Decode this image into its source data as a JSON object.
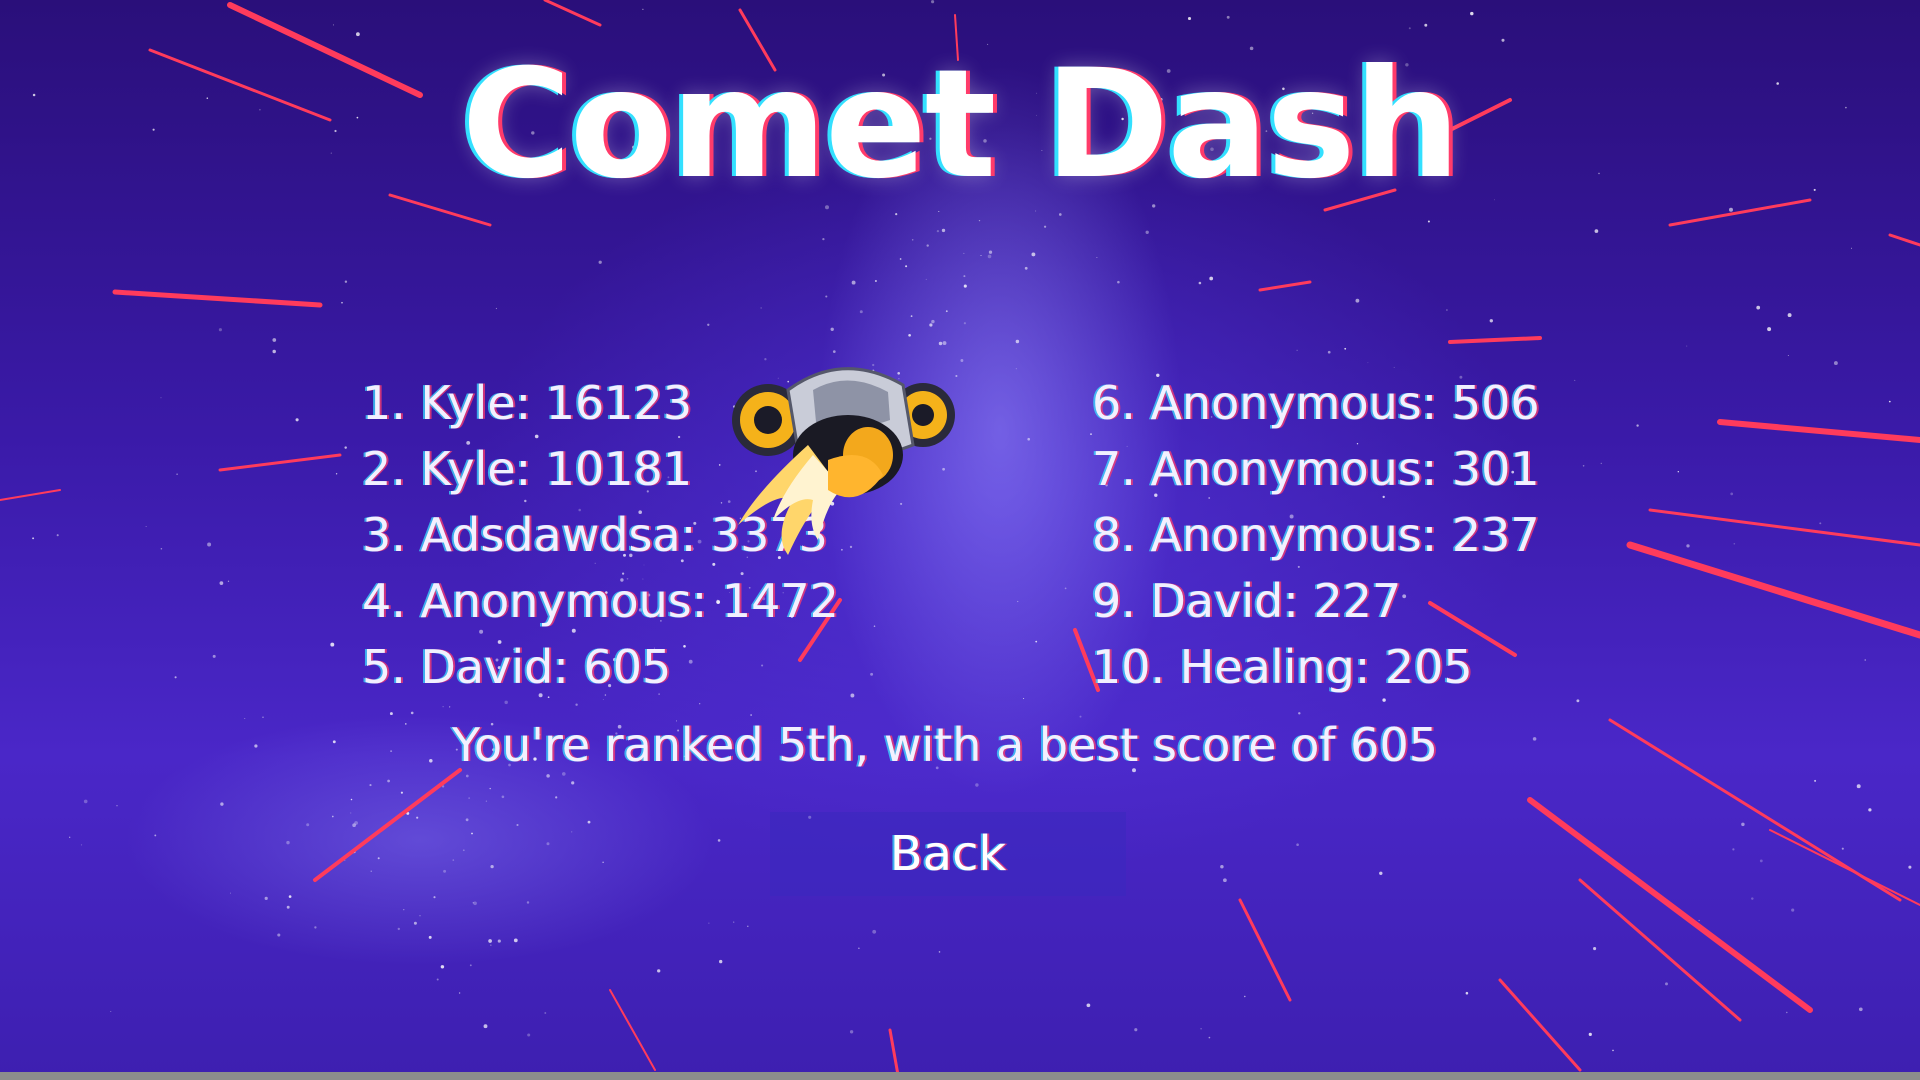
{
  "game": {
    "title": "Comet Dash"
  },
  "leaderboard": {
    "left_column": [
      "1. Kyle: 16123",
      "2. Kyle: 10181",
      "3. Adsdawdsa: 3373",
      "4. Anonymous: 1472",
      "5. David: 605"
    ],
    "right_column": [
      "6. Anonymous: 506",
      "7. Anonymous: 301",
      "8. Anonymous: 237",
      "9. David: 227",
      "10. Healing: 205"
    ]
  },
  "player_summary": "You're ranked 5th, with a best score of 605",
  "buttons": {
    "back_label": "Back"
  },
  "icons": {
    "ship": "spaceship-icon"
  },
  "colors": {
    "background_deep": "#2a0f7a",
    "background_mid": "#4a27c8",
    "streak": "#ff3b5c",
    "text": "#f2f0ff",
    "button_bg": "#3c28be"
  }
}
